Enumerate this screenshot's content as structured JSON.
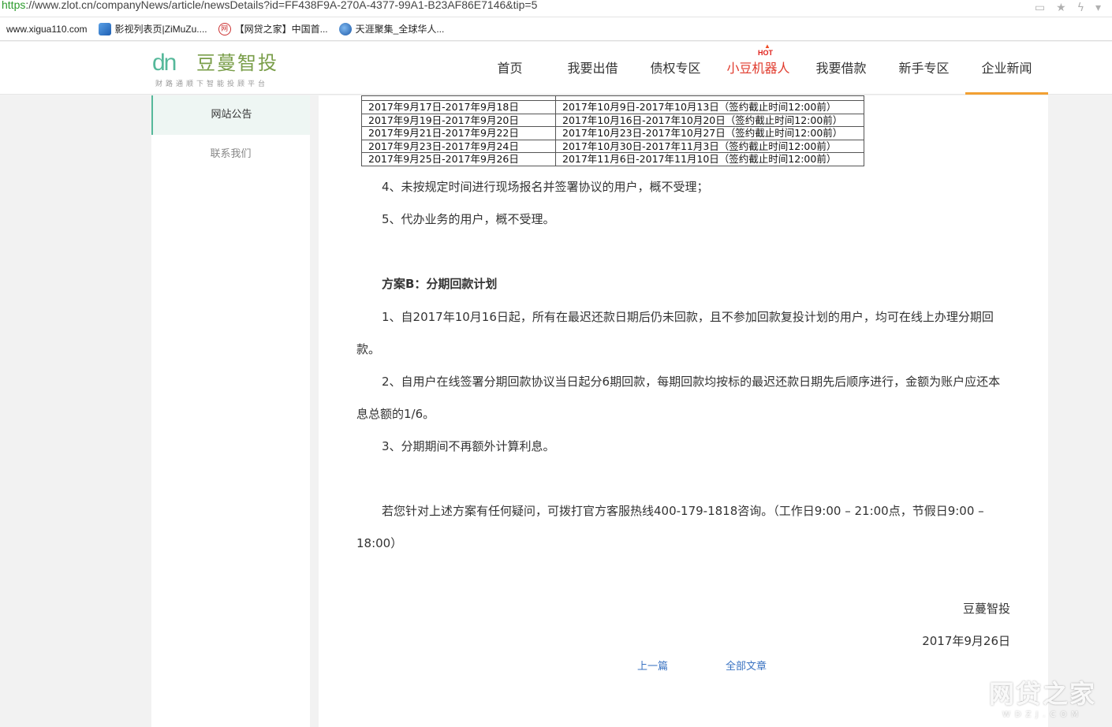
{
  "browser": {
    "url_scheme": "https",
    "url_rest": "://www.zlot.cn/companyNews/article/newsDetails?id=FF438F9A-270A-4377-99A1-B23AF86E7146&tip=5",
    "bookmarks": [
      {
        "label": "www.xigua110.com",
        "icon": "watermelon-icon"
      },
      {
        "label": "影视列表页|ZiMuZu....",
        "icon": "zimuzu-icon"
      },
      {
        "label": "【网贷之家】中国首...",
        "icon": "wdzj-icon"
      },
      {
        "label": "天涯聚集_全球华人...",
        "icon": "globe-icon"
      }
    ]
  },
  "header": {
    "logo_mark": "dn",
    "logo_name": "豆蔓智投",
    "logo_slogan": "财路通顺下智能投顾平台",
    "nav": [
      {
        "label": "首页"
      },
      {
        "label": "我要出借"
      },
      {
        "label": "债权专区"
      },
      {
        "label": "小豆机器人",
        "badge": "HOT"
      },
      {
        "label": "我要借款"
      },
      {
        "label": "新手专区"
      },
      {
        "label": "企业新闻"
      }
    ],
    "accent_color": "#f2a032",
    "hot_color": "#e03a2c"
  },
  "sidebar": {
    "items": [
      {
        "label": "网站公告"
      },
      {
        "label": "联系我们"
      }
    ]
  },
  "article": {
    "schedule_rows": [
      [
        "2017年9月17日-2017年9月18日",
        "2017年10月9日-2017年10月13日（签约截止时间12:00前）"
      ],
      [
        "2017年9月19日-2017年9月20日",
        "2017年10月16日-2017年10月20日（签约截止时间12:00前）"
      ],
      [
        "2017年9月21日-2017年9月22日",
        "2017年10月23日-2017年10月27日（签约截止时间12:00前）"
      ],
      [
        "2017年9月23日-2017年9月24日",
        "2017年10月30日-2017年11月3日（签约截止时间12:00前）"
      ],
      [
        "2017年9月25日-2017年9月26日",
        "2017年11月6日-2017年11月10日（签约截止时间12:00前）"
      ]
    ],
    "p4": "4、未按规定时间进行现场报名并签署协议的用户，概不受理；",
    "p5": "5、代办业务的用户，概不受理。",
    "planb_title": "方案B：分期回款计划",
    "b1": "1、自2017年10月16日起，所有在最迟还款日期后仍未回款，且不参加回款复投计划的用户，均可在线上办理分期回款。",
    "b2": "2、自用户在线签署分期回款协议当日起分6期回款，每期回款均按标的最迟还款日期先后顺序进行，金额为账户应还本息总额的1/6。",
    "b3": "3、分期期间不再额外计算利息。",
    "contact": "若您针对上述方案有任何疑问，可拨打官方客服热线400-179-1818咨询。（工作日9:00 – 21:00点，节假日9:00 – 18:00）",
    "signature": "豆蔓智投",
    "date": "2017年9月26日",
    "prev_label": "上一篇",
    "all_label": "全部文章"
  },
  "watermark": {
    "big": "网贷之家",
    "small": "WDZJ.COM"
  }
}
